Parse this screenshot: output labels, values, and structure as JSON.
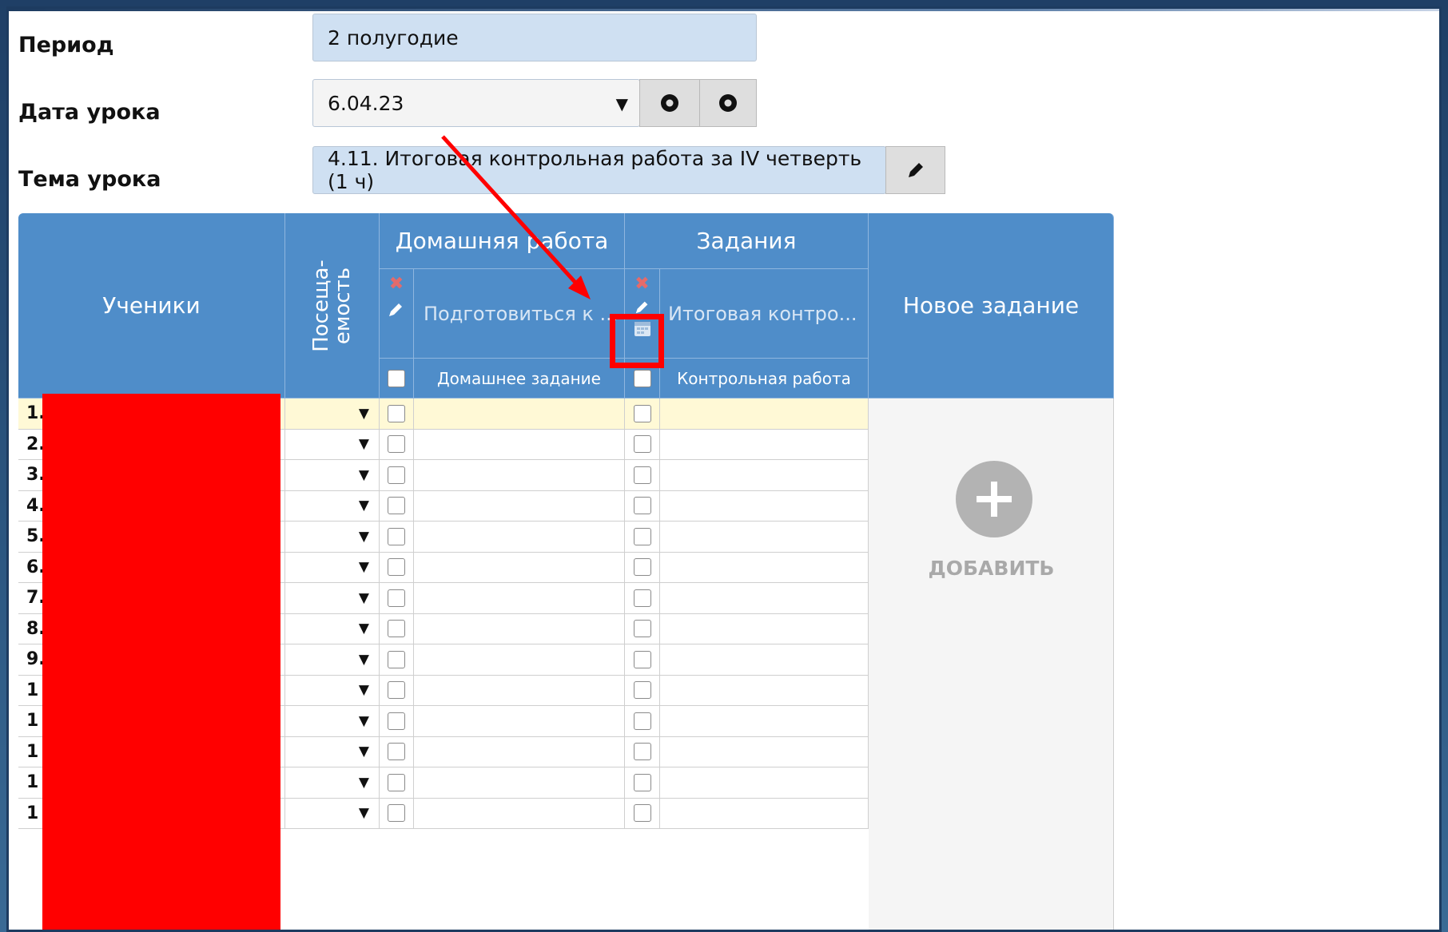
{
  "form": {
    "period_label": "Период",
    "period_value": "2 полугодие",
    "date_label": "Дата урока",
    "date_value": "6.04.23",
    "topic_label": "Тема урока",
    "topic_value": "4.11. Итоговая контрольная работа за IV четверть (1 ч)"
  },
  "table": {
    "students_header": "Ученики",
    "attendance_header": "Посеща-\nемость",
    "homework_group": "Домашняя работа",
    "homework_title": "Подготовиться к ...",
    "homework_type": "Домашнее задание",
    "tasks_group": "Задания",
    "task_title": "Итоговая контро...",
    "task_type": "Контрольная работа",
    "new_task_header": "Новое задание",
    "add_label": "ДОБАВИТЬ",
    "row_numbers": [
      "1.",
      "2.",
      "3.",
      "4.",
      "5.",
      "6.",
      "7.",
      "8.",
      "9.",
      "1",
      "1",
      "1",
      "1",
      "1"
    ]
  },
  "icons": {
    "dropdown": "caret-down-icon",
    "prev": "circle-left-icon",
    "next": "circle-right-icon",
    "edit": "pencil-icon",
    "delete": "close-icon",
    "calendar": "calendar-icon",
    "add": "plus-circle-icon"
  },
  "colors": {
    "header_blue": "#4f8dc9",
    "field_blue": "#cfe0f2",
    "highlight_row": "#fff9d6",
    "annotation_red": "#ff0000",
    "delete_red": "#e46b6b"
  }
}
